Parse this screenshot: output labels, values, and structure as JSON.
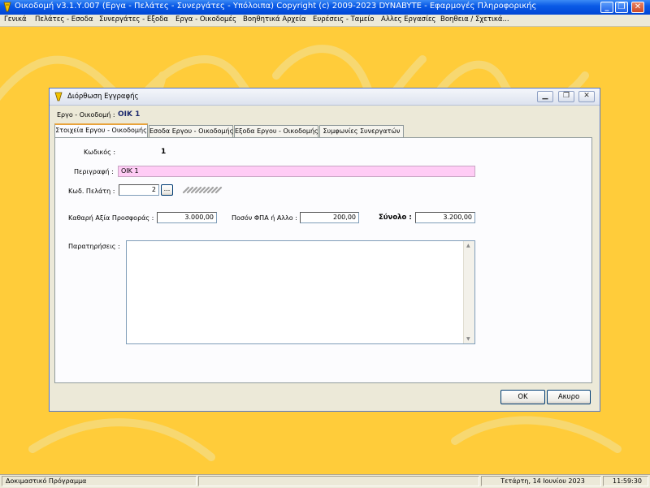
{
  "window": {
    "title": "Οικοδομή v3.1.Υ.007  (Εργα - Πελάτες - Συνεργάτες - Υπόλοιπα)   Copyright (c) 2009-2023  DYNABYTE - Εφαρμογές Πληροφορικής"
  },
  "menu": [
    "Γενικά",
    "Πελάτες - Εσοδα",
    "Συνεργάτες - Εξοδα",
    "Εργα - Οικοδομές",
    "Βοηθητικά Αρχεία",
    "Ευρέσεις - Ταμείο",
    "Αλλες Εργασίες",
    "Βοηθεια / Σχετικά..."
  ],
  "dialog": {
    "title": "Διόρθωση Εγγραφής",
    "project_label": "Εργο - Οικοδομή :",
    "project_value": "ΟΙΚ 1",
    "tabs": [
      "Στοιχεία Εργου - Οικοδομής",
      "Εσοδα Εργου - Οικοδομής",
      "Εξοδα Εργου - Οικοδομής",
      "Συμφωνίες Συνεργατών"
    ],
    "code_label": "Κωδικός :",
    "code_value": "1",
    "description_label": "Περιγραφή :",
    "description_value": "ΟΙΚ 1",
    "client_code_label": "Κωδ. Πελάτη :",
    "client_code_value": "2",
    "client_browse_label": "...",
    "net_value_label": "Καθαρή Αξία Προσφοράς :",
    "net_value": "3.000,00",
    "vat_label": "Ποσόν ΦΠΑ ή Αλλο :",
    "vat_value": "200,00",
    "total_label": "Σύνολο :",
    "total_value": "3.200,00",
    "notes_label": "Παρατηρήσεις :",
    "notes_value": "",
    "ok_label": "OK",
    "cancel_label": "Ακυρο"
  },
  "status": {
    "program": "Δοκιμαστικό Πρόγραμμα",
    "date": "Τετάρτη, 14 Ιουνίου 2023",
    "time": "11:59:30"
  },
  "colors": {
    "desktop": "#ffcc3a",
    "title_bar": "#0a5ae6",
    "description_field": "#ffccf5",
    "project_value": "#1c2a6e",
    "tab_highlight": "#e8a33c"
  }
}
